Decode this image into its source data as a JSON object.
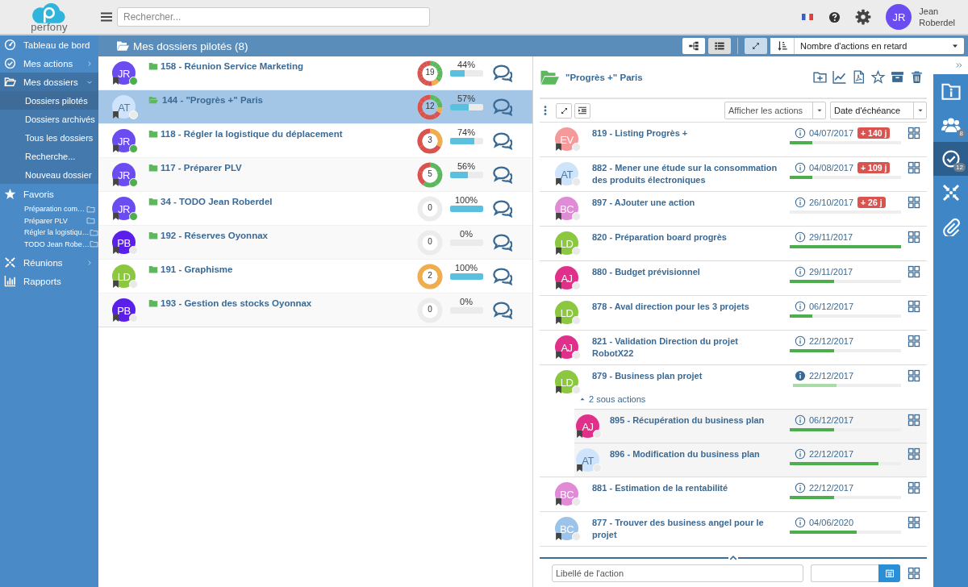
{
  "app": {
    "logo": "perfony"
  },
  "topbar": {
    "search": {
      "placeholder": "Rechercher..."
    },
    "user": {
      "initials": "JR",
      "first_name": "Jean",
      "last_name": "Roberdel"
    }
  },
  "sidebar": {
    "items": [
      {
        "kind": "link",
        "label": "Tableau de bord",
        "selected": false
      },
      {
        "kind": "link",
        "label": "Mes actions",
        "selected": false,
        "expanded": false
      },
      {
        "kind": "link",
        "label": "Mes dossiers",
        "selected": true,
        "expanded": true,
        "children": [
          {
            "kind": "sub",
            "label": "Dossiers pilotés",
            "selected": true
          },
          {
            "kind": "sub",
            "label": "Dossiers archivés",
            "selected": false
          },
          {
            "kind": "sub",
            "label": "Tous les dossiers",
            "selected": false
          },
          {
            "kind": "sub",
            "label": "Recherche...",
            "selected": false
          },
          {
            "kind": "sub",
            "label": "Nouveau dossier",
            "selected": false
          }
        ]
      },
      {
        "kind": "section",
        "label": "Favoris",
        "selected": false,
        "children": [
          {
            "kind": "favorite",
            "label": "Préparation com…",
            "selected": false
          },
          {
            "kind": "favorite",
            "label": "Préparer PLV",
            "selected": false
          },
          {
            "kind": "favorite",
            "label": "Régler la logistiqu…",
            "selected": false
          },
          {
            "kind": "favorite",
            "label": "TODO Jean Robe…",
            "selected": false
          }
        ]
      },
      {
        "kind": "link",
        "label": "Réunions",
        "selected": false,
        "expanded": false
      },
      {
        "kind": "link",
        "label": "Rapports",
        "selected": false
      }
    ]
  },
  "header": {
    "title": "Mes dossiers pilotés (8)",
    "views": [
      {
        "selected": false
      },
      {
        "selected": true
      }
    ],
    "expand_toggle": {
      "on": true
    },
    "sort": {
      "value": "Nombre d'actions en retard"
    }
  },
  "folders": {
    "rows": [
      {
        "title": "158 - Réunion Service Marketing",
        "selected": false,
        "avatar": {
          "initials": "JR",
          "color": "#6a4cf0",
          "active": true
        },
        "donut": {
          "count": "19",
          "slices": [
            {
              "color": "#5cb85c"
            },
            {
              "color": "#5cb85c"
            },
            {
              "color": "#5cb85c"
            },
            {
              "color": "#5cb85c"
            },
            {
              "color": "#5cb85c"
            },
            {
              "color": "#5cb85c"
            },
            {
              "color": "#5cb85c"
            },
            {
              "color": "#f0ad4e"
            },
            {
              "color": "#f0ad4e"
            },
            {
              "color": "#d9534f"
            },
            {
              "color": "#d9534f"
            },
            {
              "color": "#d9534f"
            },
            {
              "color": "#d9534f"
            },
            {
              "color": "#d9534f"
            },
            {
              "color": "#d9534f"
            },
            {
              "color": "#d9534f"
            },
            {
              "color": "#d9534f"
            },
            {
              "color": "#d9534f"
            },
            {
              "color": "#d9534f"
            }
          ]
        },
        "percent": "44%",
        "level": 0.44
      },
      {
        "title": "144 - \"Progrès +\" Paris",
        "selected": true,
        "avatar": {
          "initials": "AT",
          "color": "#cfe4fa",
          "active": false
        },
        "donut": {
          "count": "12",
          "slices": [
            {
              "color": "#5cb85c"
            },
            {
              "color": "#5cb85c"
            },
            {
              "color": "#5cb85c"
            },
            {
              "color": "#f0ad4e"
            },
            {
              "color": "#d9534f"
            },
            {
              "color": "#d9534f"
            },
            {
              "color": "#d9534f"
            },
            {
              "color": "#d9534f"
            },
            {
              "color": "#d9534f"
            },
            {
              "color": "#d9534f"
            },
            {
              "color": "#d9534f"
            },
            {
              "color": "#d9534f"
            }
          ]
        },
        "percent": "57%",
        "level": 0.57
      },
      {
        "title": "118 - Régler la logistique du déplacement",
        "selected": false,
        "avatar": {
          "initials": "JR",
          "color": "#6a4cf0",
          "active": true
        },
        "donut": {
          "count": "3",
          "slices": [
            {
              "color": "#f0ad4e"
            },
            {
              "color": "#d9534f"
            },
            {
              "color": "#d9534f"
            }
          ]
        },
        "percent": "74%",
        "level": 0.74
      },
      {
        "title": "117 - Préparer PLV",
        "selected": false,
        "avatar": {
          "initials": "JR",
          "color": "#6a4cf0",
          "active": true
        },
        "donut": {
          "count": "5",
          "slices": [
            {
              "color": "#5cb85c"
            },
            {
              "color": "#5cb85c"
            },
            {
              "color": "#5cb85c"
            },
            {
              "color": "#d9534f"
            },
            {
              "color": "#d9534f"
            }
          ]
        },
        "percent": "56%",
        "level": 0.56
      },
      {
        "title": "34 - TODO Jean Roberdel",
        "selected": false,
        "avatar": {
          "initials": "JR",
          "color": "#6a4cf0",
          "active": true
        },
        "donut": {
          "count": "0"
        },
        "percent": "100%",
        "level": 1
      },
      {
        "title": "192 - Réserves Oyonnax",
        "selected": false,
        "avatar": {
          "initials": "PB",
          "color": "#5a1fe8",
          "active": false
        },
        "donut": {
          "count": "0"
        },
        "percent": "0%",
        "level": 0
      },
      {
        "title": "191 - Graphisme",
        "selected": false,
        "avatar": {
          "initials": "LD",
          "color": "#8cc83f",
          "active": false
        },
        "donut": {
          "count": "2",
          "slices": [
            {
              "color": "#f0ad4e"
            },
            {
              "color": "#f0ad4e"
            }
          ]
        },
        "percent": "100%",
        "level": 1
      },
      {
        "title": "193 - Gestion des stocks Oyonnax",
        "selected": false,
        "avatar": {
          "initials": "PB",
          "color": "#5a1fe8",
          "active": false
        },
        "donut": {
          "count": "0"
        },
        "percent": "0%",
        "level": 0
      }
    ]
  },
  "detail": {
    "title": "\"Progrès +\" Paris",
    "filter": {
      "placeholder": "Afficher les actions"
    },
    "sort": {
      "value": "Date d'échéance"
    },
    "actions": [
      {
        "kind": "single",
        "title": "819 - Listing Progrès +",
        "avatar": {
          "initials": "EV",
          "color": "#f59a9a",
          "active": false
        },
        "date": "04/07/2017",
        "overdue": "+ 140 j",
        "level": 0.2
      },
      {
        "kind": "single",
        "title": "882 - Mener une étude sur la consommation des produits électroniques",
        "avatar": {
          "initials": "AT",
          "color": "#cfe4fa",
          "active": false
        },
        "date": "04/08/2017",
        "overdue": "+ 109 j",
        "level": 0.2
      },
      {
        "kind": "single",
        "title": "897 - AJouter une action",
        "avatar": {
          "initials": "BC",
          "color": "#df8bd6",
          "active": false
        },
        "date": "26/10/2017",
        "overdue": "+ 26 j",
        "level": 0
      },
      {
        "kind": "single",
        "title": "820 - Préparation board progrès",
        "avatar": {
          "initials": "LD",
          "color": "#8cc83f",
          "active": false
        },
        "date": "29/11/2017",
        "level": 1
      },
      {
        "kind": "single",
        "title": "880 - Budget prévisionnel",
        "avatar": {
          "initials": "AJ",
          "color": "#e0308a",
          "active": false
        },
        "date": "29/11/2017",
        "level": 0.4
      },
      {
        "kind": "single",
        "title": "878 - Aval direction pour les 3 projets",
        "avatar": {
          "initials": "LD",
          "color": "#8cc83f",
          "active": false
        },
        "date": "06/12/2017",
        "level": 0.2
      },
      {
        "kind": "single",
        "title": "821 - Validation Direction du projet RobotX22",
        "avatar": {
          "initials": "AJ",
          "color": "#e0308a",
          "active": false
        },
        "date": "22/12/2017",
        "level": 0.4
      },
      {
        "kind": "parent",
        "title": "879 - Business plan projet",
        "avatar": {
          "initials": "LD",
          "color": "#8cc83f",
          "active": false
        },
        "date": "22/12/2017",
        "level": 0.4,
        "children_label": "2 sous actions",
        "expanded": true,
        "children": [
          {
            "kind": "single",
            "title": "895 - Récupération du business plan",
            "avatar": {
              "initials": "AJ",
              "color": "#e0308a",
              "active": false
            },
            "date": "06/12/2017",
            "level": 0.4
          },
          {
            "kind": "single",
            "title": "896 - Modification du business plan",
            "avatar": {
              "initials": "AT",
              "color": "#cfe4fa",
              "active": false
            },
            "date": "22/12/2017",
            "level": 0.8
          }
        ]
      },
      {
        "kind": "single",
        "title": "881 - Estimation de la rentabilité",
        "avatar": {
          "initials": "BC",
          "color": "#df8bd6",
          "active": false
        },
        "date": "22/12/2017",
        "level": 0.4
      },
      {
        "kind": "single",
        "title": "877 - Trouver des business angel pour le projet",
        "avatar": {
          "initials": "BC",
          "color": "#9cc3ea",
          "active": false
        },
        "date": "04/06/2020",
        "level": 0.6
      }
    ],
    "new_action": {
      "placeholder": "Libellé de l'action"
    }
  },
  "rail": {
    "items": [
      {
        "selected": false
      },
      {
        "selected": false,
        "badge": "8"
      },
      {
        "selected": true,
        "badge": "12"
      },
      {
        "selected": false
      },
      {
        "selected": false
      }
    ]
  }
}
